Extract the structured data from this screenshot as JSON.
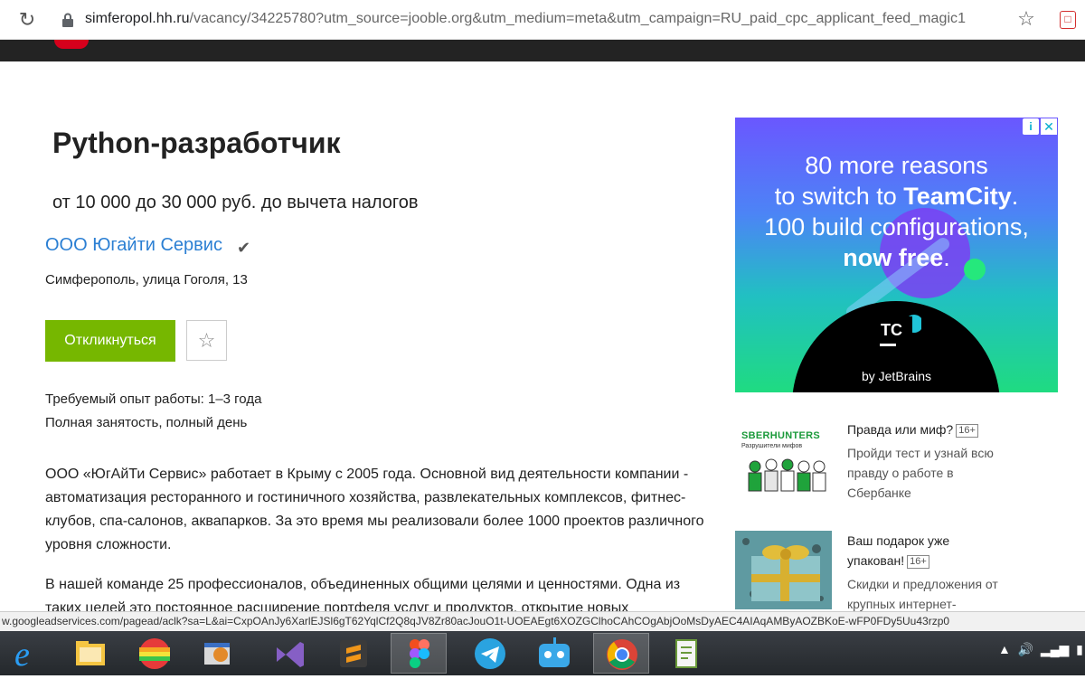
{
  "browser": {
    "url_host": "simferopol.hh.ru",
    "url_path": "/vacancy/34225780?utm_source=jooble.org&utm_medium=meta&utm_campaign=RU_paid_cpc_applicant_feed_magic1",
    "status_link": "w.googleadservices.com/pagead/aclk?sa=L&ai=CxpOAnJy6XarlEJSl6gT62YqlCf2Q8qJV8Zr80acJouO1t-UOEAEgt6XOZGClhoCAhCOgAbjOoMsDyAEC4AIAqAMByAOZBKoE-wFP0FDy5Uu43rzp0"
  },
  "vacancy": {
    "title": "Python-разработчик",
    "salary": "от 10 000 до 30 000 руб. до вычета налогов",
    "company": "ООО Югайти Сервис",
    "address": "Симферополь, улица Гоголя, 13",
    "apply_label": "Откликнуться",
    "experience": "Требуемый опыт работы: 1–3 года",
    "employment": "Полная занятость, полный день",
    "paragraph1": "ООО «ЮгАйТи Сервис» работает в Крыму с 2005 года. Основной вид деятельности компании - автоматизация ресторанного и гостиничного хозяйства, развлекательных комплексов, фитнес-клубов, спа-салонов, аквапарков. За это время мы реализовали более 1000 проектов различного уровня сложности.",
    "paragraph2": "В нашей команде 25 профессионалов, объединенных общими целями и ценностями. Одна из таких целей это постоянное расширение портфеля услуг и продуктов, открытие новых"
  },
  "ad": {
    "line1": "80 more reasons",
    "line2_pre": "to switch to ",
    "line2_bold": "TeamCity",
    "line2_post": ".",
    "line3": "100 build configurations,",
    "line4_bold": "now free",
    "line4_post": ".",
    "tc_letters": "TC",
    "by": "by JetBrains",
    "info": "i",
    "close": "✕"
  },
  "promos": [
    {
      "title": "Правда или миф?",
      "age": "16+",
      "desc": "Пройди тест и узнай всю правду о работе в Сбербанке",
      "img_title": "SBERHUNTERS",
      "img_sub": "Разрушители мифов"
    },
    {
      "title": "Ваш подарок уже упакован!",
      "age": "16+",
      "desc": "Скидки и предложения от крупных интернет-"
    }
  ],
  "colors": {
    "apply_green": "#76b700",
    "link_blue": "#2b7fd3",
    "header_dark": "#232323"
  },
  "icons": [
    "reload-icon",
    "lock-icon",
    "bookmark-star-icon",
    "extension-icon",
    "verified-check-icon",
    "favorite-star-icon"
  ],
  "taskbar": [
    "internet-explorer",
    "file-explorer",
    "colorful-app",
    "settings-app",
    "visual-studio",
    "sublime-text",
    "figma",
    "telegram",
    "bot-app",
    "chrome",
    "notepad-plus"
  ]
}
